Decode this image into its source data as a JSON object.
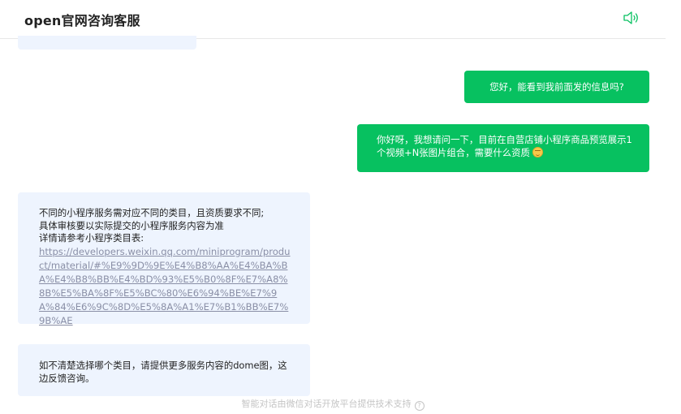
{
  "header": {
    "title": "open官网咨询客服",
    "speaker_icon": "speaker-icon"
  },
  "messages": {
    "user_1": "您好，能看到我前面发的信息吗?",
    "user_2": "你好呀，我想请问一下，目前在自营店铺小程序商品预览展示1个视频+N张图片组合，需要什么资质",
    "user_2_emoji": "smiling-face-emoji",
    "bot_1": {
      "line_1": "不同的小程序服务需对应不同的类目，且资质要求不同;",
      "line_2": "具体审核要以实际提交的小程序服务内容为准",
      "line_3": "详情请参考小程序类目表:",
      "link": "https://developers.weixin.qq.com/miniprogram/product/material/#%E9%9D%9E%E4%B8%AA%E4%BA%BA%E4%B8%BB%E4%BD%93%E5%B0%8F%E7%A8%8B%E5%BA%8F%E5%BC%80%E6%94%BE%E7%9A%84%E6%9C%8D%E5%8A%A1%E7%B1%BB%E7%9B%AE"
    },
    "bot_2": "如不清楚选择哪个类目，请提供更多服务内容的dome图，这边反馈咨询。"
  },
  "footer": {
    "text": "智能对话由微信对话开放平台提供技术支持",
    "help_glyph": "?"
  },
  "colors": {
    "user_bubble": "#07c160",
    "bot_bubble": "#eef4fe",
    "speaker": "#07c160"
  }
}
